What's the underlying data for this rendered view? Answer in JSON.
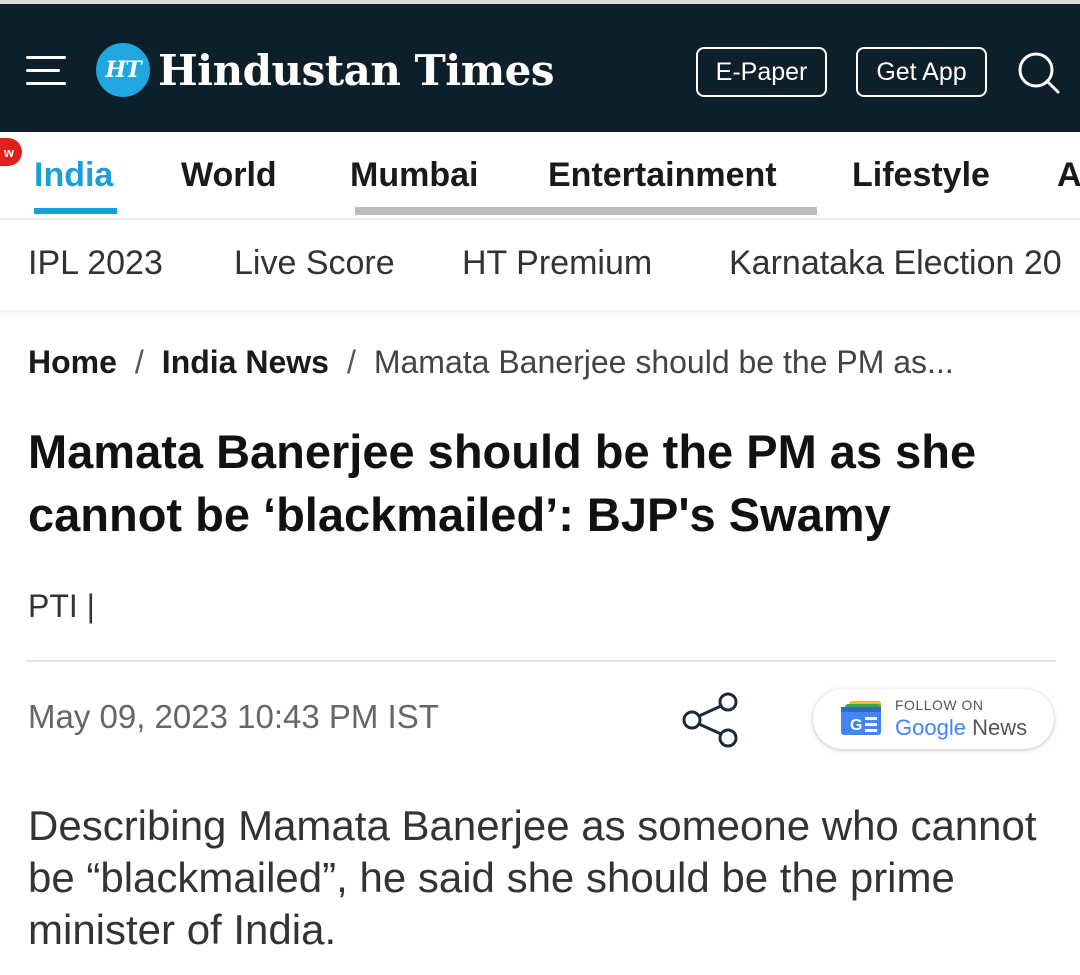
{
  "header": {
    "logo_badge": "HT",
    "logo_text": "Hindustan Times",
    "epaper_label": "E-Paper",
    "get_app_label": "Get App"
  },
  "nav": {
    "new_badge": "w",
    "items": [
      {
        "label": "India"
      },
      {
        "label": "World"
      },
      {
        "label": "Mumbai"
      },
      {
        "label": "Entertainment"
      },
      {
        "label": "Lifestyle"
      },
      {
        "label": "A"
      }
    ]
  },
  "subnav": {
    "items": [
      {
        "label": "IPL 2023"
      },
      {
        "label": "Live Score"
      },
      {
        "label": "HT Premium"
      },
      {
        "label": "Karnataka Election 20"
      }
    ]
  },
  "breadcrumb": {
    "home": "Home",
    "section": "India News",
    "current": "Mamata Banerjee should be the PM as...",
    "separator": "/"
  },
  "article": {
    "headline": "Mamata Banerjee should be the PM as she cannot be ‘blackmailed’: BJP's Swamy",
    "byline": "PTI |",
    "timestamp": "May 09, 2023 10:43 PM IST",
    "body": "Describing Mamata Banerjee as someone who cannot be “blackmailed”, he said she should be the prime minister of India."
  },
  "google_news": {
    "follow_on": "FOLLOW ON",
    "brand": "Google",
    "product": "News"
  },
  "colors": {
    "header_bg": "#0c1f2a",
    "accent": "#1a9fd8",
    "logo_badge": "#20a6e0"
  }
}
